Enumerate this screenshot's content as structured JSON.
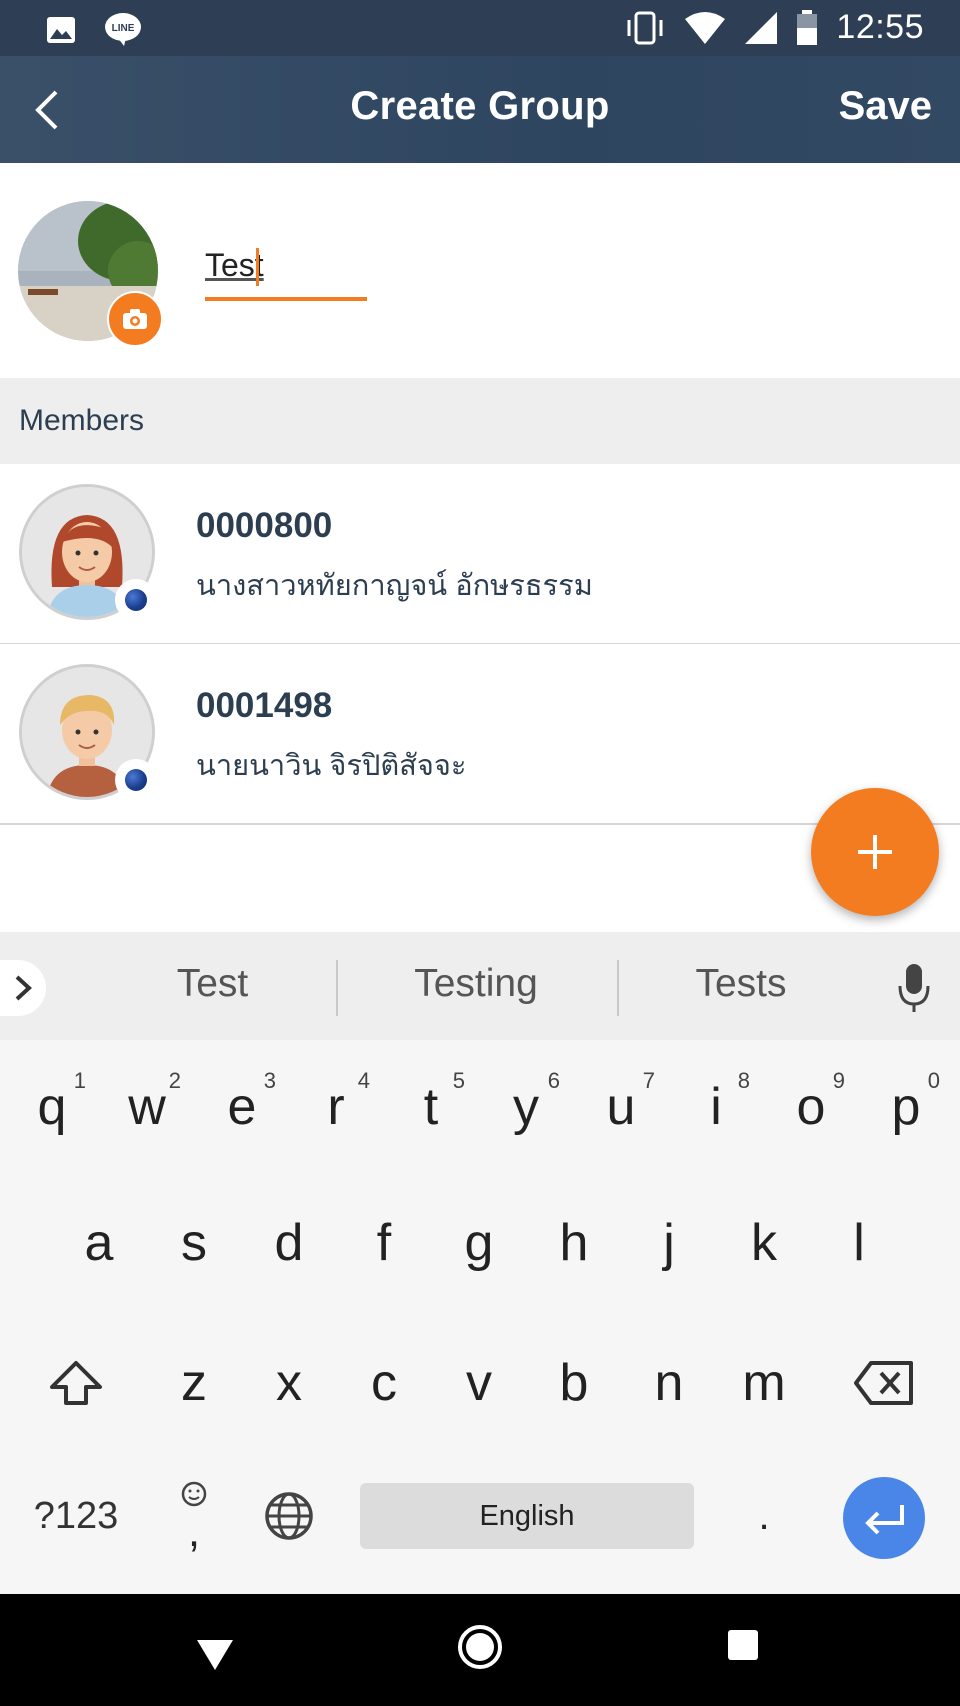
{
  "status_bar": {
    "time": "12:55",
    "icons": [
      "image-icon",
      "line-icon",
      "vibrate-icon",
      "wifi-icon",
      "signal-icon",
      "battery-icon"
    ]
  },
  "app_bar": {
    "title": "Create Group",
    "save_label": "Save",
    "back_icon": "back-arrow-icon"
  },
  "group": {
    "name_value": "Test"
  },
  "members": {
    "header": "Members",
    "items": [
      {
        "id": "0000800",
        "name": "นางสาวหทัยกาญจน์  อักษรธรรม"
      },
      {
        "id": "0001498",
        "name": "นายนาวิน จิรปิติสัจจะ"
      }
    ]
  },
  "fab": {
    "icon": "plus-icon"
  },
  "suggestions": {
    "items": [
      "Test",
      "Testing",
      "Tests"
    ]
  },
  "keyboard": {
    "row1": [
      "q",
      "w",
      "e",
      "r",
      "t",
      "y",
      "u",
      "i",
      "o",
      "p"
    ],
    "row1_hints": [
      "1",
      "2",
      "3",
      "4",
      "5",
      "6",
      "7",
      "8",
      "9",
      "0"
    ],
    "row2": [
      "a",
      "s",
      "d",
      "f",
      "g",
      "h",
      "j",
      "k",
      "l"
    ],
    "row3": [
      "z",
      "x",
      "c",
      "v",
      "b",
      "n",
      "m"
    ],
    "symbols_label": "?123",
    "space_label": "English",
    "period_label": ".",
    "comma_label": ","
  },
  "colors": {
    "accent": "#f47c20",
    "header": "#2e4560",
    "enter_key": "#4a86e8"
  }
}
